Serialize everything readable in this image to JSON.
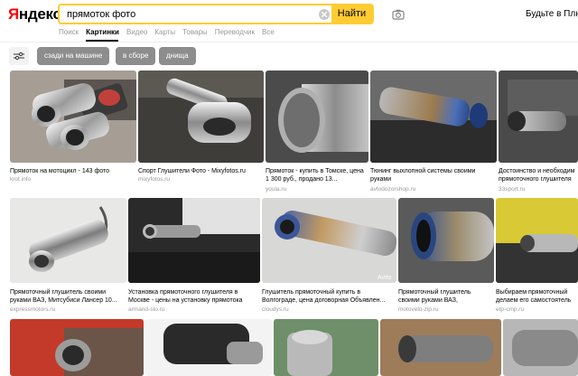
{
  "header": {
    "logo_first": "Я",
    "logo_rest": "ндекс",
    "search_value": "прямоток фото",
    "search_button": "Найти",
    "plus_link": "Будьте в Плюсе"
  },
  "nav": {
    "tabs": [
      "Поиск",
      "Картинки",
      "Видео",
      "Карты",
      "Товары",
      "Переводчик",
      "Все"
    ],
    "active": "Картинки"
  },
  "filters": {
    "chips": [
      "сзади на машине",
      "в сборе",
      "днища"
    ]
  },
  "results": [
    {
      "caption": "Прямоток на мотоцикл - 143 фото",
      "source": "krot.info"
    },
    {
      "caption": "Спорт Глушители Фото - Mixyfotos.ru",
      "source": "mixyfotos.ru"
    },
    {
      "caption": "Прямоток - купить в Томске, цена 1 300 руб., продано 13...",
      "source": "youla.ru"
    },
    {
      "caption": "Тюнинг выхлопной системы своими руками",
      "source": "avtodozorshop.ru"
    },
    {
      "caption": "Достоинство и необходим прямоточного глушителя",
      "source": "33sport.ru"
    },
    {
      "caption": "Прямоточный глушитель своими руками ВАЗ, Митсубиси Лансер 10...",
      "source": "expressmotors.ru"
    },
    {
      "caption": "Установка прямоточного глушителя в Москве - цены на установку прямотока",
      "source": "armand-sto.ru"
    },
    {
      "caption": "Глушитель прямоточный купить в Волгограде, цена договорная Объявлен...",
      "source": "cloudys.ru"
    },
    {
      "caption": "Прямоточный глушитель своими руками ВАЗ,",
      "source": "motovelo-zip.ru"
    },
    {
      "caption": "Выбираем прямоточный делаем его самостоятель",
      "source": "etp-cmp.ru"
    }
  ],
  "watermark": "Avito"
}
